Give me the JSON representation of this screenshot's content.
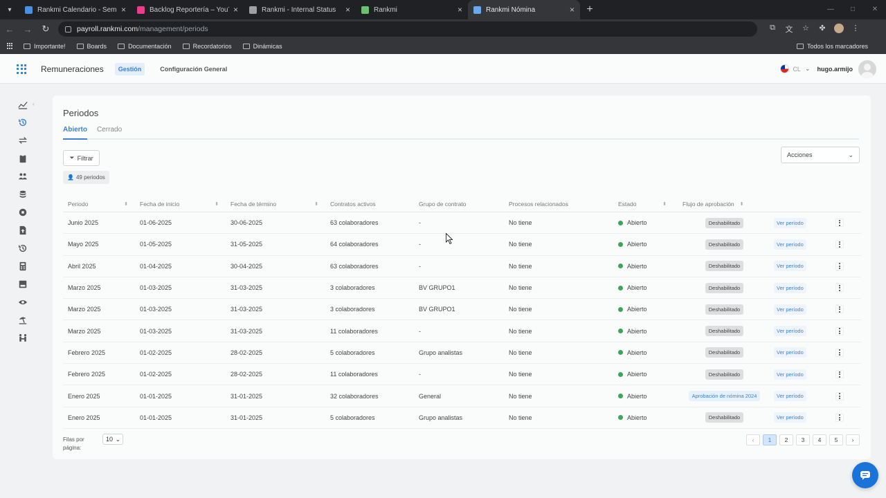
{
  "browser": {
    "tabs": [
      {
        "title": "Rankmi Calendario - Semana de",
        "color": "#4a8fe0",
        "active": false
      },
      {
        "title": "Backlog Reportería – YouTrack",
        "color": "#e83e8c",
        "active": false
      },
      {
        "title": "Rankmi - Internal Status",
        "color": "#a0a0a0",
        "active": false
      },
      {
        "title": "Rankmi",
        "color": "#6cc070",
        "active": false
      },
      {
        "title": "Rankmi Nómina",
        "color": "#6aa9ef",
        "active": true
      }
    ],
    "url_host": "payroll.rankmi.com",
    "url_path": "/management/periods",
    "bookmarks": [
      "Importante!",
      "Boards",
      "Documentación",
      "Recordatorios",
      "Dinámicas"
    ],
    "bookmarks_right": "Todos los marcadores"
  },
  "header": {
    "app_name": "Remuneraciones",
    "nav_active": "Gestión",
    "nav_other": "Configuración General",
    "country": "CL",
    "username": "hugo.armijo"
  },
  "page": {
    "title": "Periodos",
    "tabs": [
      "Abierto",
      "Cerrado"
    ],
    "filter_label": "Filtrar",
    "count_label": "49 periodos",
    "actions_label": "Acciones"
  },
  "table": {
    "columns": [
      "Periodo",
      "Fecha de inicio",
      "Fecha de término",
      "Contratos activos",
      "Grupo de contrato",
      "Procesos relacionados",
      "Estado",
      "Flujo de aprobación"
    ],
    "link_label": "Ver período",
    "rows": [
      {
        "periodo": "Junio 2025",
        "inicio": "01-06-2025",
        "termino": "30-06-2025",
        "contratos": "63 colaboradores",
        "grupo": "-",
        "procesos": "No tiene",
        "estado": "Abierto",
        "flujo": "Deshabilitado"
      },
      {
        "periodo": "Mayo 2025",
        "inicio": "01-05-2025",
        "termino": "31-05-2025",
        "contratos": "64 colaboradores",
        "grupo": "-",
        "procesos": "No tiene",
        "estado": "Abierto",
        "flujo": "Deshabilitado"
      },
      {
        "periodo": "Abril 2025",
        "inicio": "01-04-2025",
        "termino": "30-04-2025",
        "contratos": "63 colaboradores",
        "grupo": "-",
        "procesos": "No tiene",
        "estado": "Abierto",
        "flujo": "Deshabilitado"
      },
      {
        "periodo": "Marzo 2025",
        "inicio": "01-03-2025",
        "termino": "31-03-2025",
        "contratos": "3 colaboradores",
        "grupo": "BV GRUPO1",
        "procesos": "No tiene",
        "estado": "Abierto",
        "flujo": "Deshabilitado"
      },
      {
        "periodo": "Marzo 2025",
        "inicio": "01-03-2025",
        "termino": "31-03-2025",
        "contratos": "3 colaboradores",
        "grupo": "BV GRUPO1",
        "procesos": "No tiene",
        "estado": "Abierto",
        "flujo": "Deshabilitado"
      },
      {
        "periodo": "Marzo 2025",
        "inicio": "01-03-2025",
        "termino": "31-03-2025",
        "contratos": "11 colaboradores",
        "grupo": "-",
        "procesos": "No tiene",
        "estado": "Abierto",
        "flujo": "Deshabilitado"
      },
      {
        "periodo": "Febrero 2025",
        "inicio": "01-02-2025",
        "termino": "28-02-2025",
        "contratos": "5 colaboradores",
        "grupo": "Grupo analistas",
        "procesos": "No tiene",
        "estado": "Abierto",
        "flujo": "Deshabilitado"
      },
      {
        "periodo": "Febrero 2025",
        "inicio": "01-02-2025",
        "termino": "28-02-2025",
        "contratos": "11 colaboradores",
        "grupo": "-",
        "procesos": "No tiene",
        "estado": "Abierto",
        "flujo": "Deshabilitado"
      },
      {
        "periodo": "Enero 2025",
        "inicio": "01-01-2025",
        "termino": "31-01-2025",
        "contratos": "32 colaboradores",
        "grupo": "General",
        "procesos": "No tiene",
        "estado": "Abierto",
        "flujo": "Aprobación de nómina 2024"
      },
      {
        "periodo": "Enero 2025",
        "inicio": "01-01-2025",
        "termino": "31-01-2025",
        "contratos": "5 colaboradores",
        "grupo": "Grupo analistas",
        "procesos": "No tiene",
        "estado": "Abierto",
        "flujo": "Deshabilitado"
      }
    ]
  },
  "footer": {
    "rows_label": "Filas por página:",
    "rows_value": "10",
    "pages": [
      "1",
      "2",
      "3",
      "4",
      "5"
    ],
    "current_page": "1"
  },
  "colors": {
    "accent": "#3b82d6",
    "status_open": "#3aa757"
  }
}
